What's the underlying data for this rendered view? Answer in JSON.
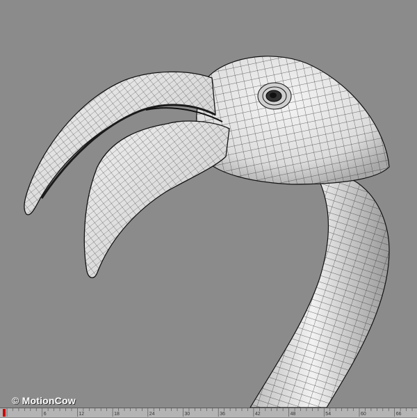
{
  "viewport": {
    "subject": "flamingo-head-wireframe",
    "background_color": "#8b8b8b",
    "mesh_fill": "#e8e8e8",
    "wire_color": "#222222"
  },
  "watermark": {
    "text": "© MotionCow"
  },
  "timeline": {
    "ticks": [
      "6",
      "12",
      "18",
      "24",
      "30",
      "36",
      "42",
      "48",
      "54",
      "60",
      "66"
    ],
    "current_frame_marker": "red"
  }
}
